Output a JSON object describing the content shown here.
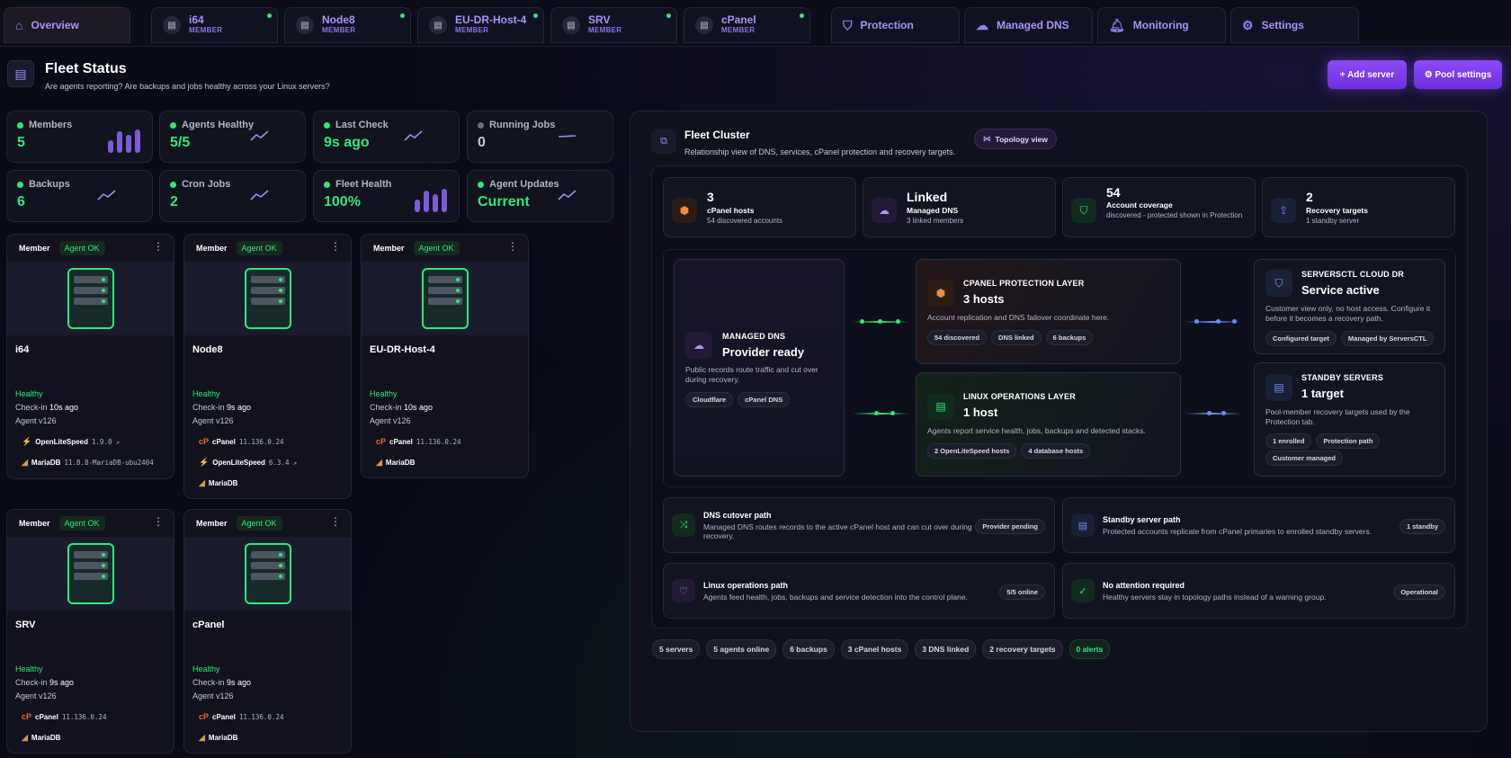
{
  "tabs": {
    "overview": {
      "label": "Overview"
    },
    "members": [
      {
        "name": "i64",
        "role": "MEMBER"
      },
      {
        "name": "Node8",
        "role": "MEMBER"
      },
      {
        "name": "EU-DR-Host-4",
        "role": "MEMBER"
      },
      {
        "name": "SRV",
        "role": "MEMBER"
      },
      {
        "name": "cPanel",
        "role": "MEMBER"
      }
    ],
    "sections": [
      {
        "label": "Protection",
        "icon": "shield-icon"
      },
      {
        "label": "Managed DNS",
        "icon": "cloud-icon"
      },
      {
        "label": "Monitoring",
        "icon": "bell-icon"
      },
      {
        "label": "Settings",
        "icon": "gear-icon"
      }
    ]
  },
  "header": {
    "title": "Fleet Status",
    "subtitle": "Are agents reporting? Are backups and jobs healthy across your Linux servers?",
    "add_server": "+ Add server",
    "pool_settings": "⚙ Pool settings"
  },
  "stats": [
    {
      "label": "Members",
      "value": "5",
      "status": "green"
    },
    {
      "label": "Agents Healthy",
      "value": "5/5",
      "status": "green"
    },
    {
      "label": "Last Check",
      "value": "9s ago",
      "status": "green"
    },
    {
      "label": "Running Jobs",
      "value": "0",
      "status": "gray"
    },
    {
      "label": "Backups",
      "value": "6",
      "status": "green"
    },
    {
      "label": "Cron Jobs",
      "value": "2",
      "status": "green"
    },
    {
      "label": "Fleet Health",
      "value": "100%",
      "status": "green"
    },
    {
      "label": "Agent Updates",
      "value": "Current",
      "status": "green"
    }
  ],
  "cards": [
    {
      "role": "Member",
      "badge": "Agent OK",
      "name": "i64",
      "health": "Healthy",
      "checkin_prefix": "Check-in ",
      "checkin": "10s ago",
      "agent": "Agent v126",
      "software": [
        {
          "name": "OpenLiteSpeed",
          "version": "1.9.0",
          "ext": "↗"
        },
        {
          "name": "MariaDB",
          "version": "11.8.8-MariaDB-ubu2404",
          "ext": ""
        }
      ]
    },
    {
      "role": "Member",
      "badge": "Agent OK",
      "name": "Node8",
      "health": "Healthy",
      "checkin_prefix": "Check-in ",
      "checkin": "9s ago",
      "agent": "Agent v126",
      "software": [
        {
          "name": "cPanel",
          "version": "11.136.0.24",
          "ext": ""
        },
        {
          "name": "OpenLiteSpeed",
          "version": "6.3.4",
          "ext": "↗"
        },
        {
          "name": "MariaDB",
          "version": "",
          "ext": ""
        }
      ]
    },
    {
      "role": "Member",
      "badge": "Agent OK",
      "name": "EU-DR-Host-4",
      "health": "Healthy",
      "checkin_prefix": "Check-in ",
      "checkin": "10s ago",
      "agent": "Agent v126",
      "software": [
        {
          "name": "cPanel",
          "version": "11.136.0.24",
          "ext": ""
        },
        {
          "name": "MariaDB",
          "version": "",
          "ext": ""
        }
      ]
    },
    {
      "role": "Member",
      "badge": "Agent OK",
      "name": "SRV",
      "health": "Healthy",
      "checkin_prefix": "Check-in ",
      "checkin": "9s ago",
      "agent": "Agent v126",
      "software": [
        {
          "name": "cPanel",
          "version": "11.136.0.24",
          "ext": ""
        },
        {
          "name": "MariaDB",
          "version": "",
          "ext": ""
        }
      ]
    },
    {
      "role": "Member",
      "badge": "Agent OK",
      "name": "cPanel",
      "health": "Healthy",
      "checkin_prefix": "Check-in ",
      "checkin": "9s ago",
      "agent": "Agent v126",
      "software": [
        {
          "name": "cPanel",
          "version": "11.136.0.24",
          "ext": ""
        },
        {
          "name": "MariaDB",
          "version": "",
          "ext": ""
        }
      ]
    }
  ],
  "cluster": {
    "title": "Fleet Cluster",
    "subtitle": "Relationship view of DNS, services, cPanel protection and recovery targets.",
    "topology_button": "Topology view",
    "kpis": [
      {
        "value": "3",
        "label": "cPanel hosts",
        "sub": "54 discovered accounts",
        "icon": "box-icon",
        "color": "#f08a3c"
      },
      {
        "value": "Linked",
        "label": "Managed DNS",
        "sub": "3 linked members",
        "icon": "cloud-icon",
        "color": "#a994f5"
      },
      {
        "value": "54",
        "label": "Account coverage",
        "sub": "discovered - protected shown in Protection",
        "icon": "shield-icon",
        "color": "#2ee87a"
      },
      {
        "value": "2",
        "label": "Recovery targets",
        "sub": "1 standby server",
        "icon": "cloud-upload-icon",
        "color": "#6c8cf5"
      }
    ],
    "dns": {
      "title": "MANAGED DNS",
      "value": "Provider ready",
      "desc": "Public records route traffic and cut over during recovery.",
      "pills": [
        "Cloudflare",
        "cPanel DNS"
      ]
    },
    "cpanel": {
      "title": "CPANEL PROTECTION LAYER",
      "value": "3 hosts",
      "desc": "Account replication and DNS failover coordinate here.",
      "pills": [
        "54 discovered",
        "DNS linked",
        "6 backups"
      ]
    },
    "linux": {
      "title": "LINUX OPERATIONS LAYER",
      "value": "1 host",
      "desc": "Agents report service health, jobs, backups and detected stacks.",
      "pills": [
        "2 OpenLiteSpeed hosts",
        "4 database hosts"
      ]
    },
    "clouddr": {
      "title": "SERVERSCTL CLOUD DR",
      "value": "Service active",
      "desc": "Customer view only, no host access. Configure it before it becomes a recovery path.",
      "pills": [
        "Configured target",
        "Managed by ServersCTL"
      ]
    },
    "standby": {
      "title": "STANDBY SERVERS",
      "value": "1 target",
      "desc": "Pool-member recovery targets used by the Protection tab.",
      "pills": [
        "1 enrolled",
        "Protection path",
        "Customer managed"
      ]
    },
    "paths": [
      {
        "title": "DNS cutover path",
        "desc": "Managed DNS routes records to the active cPanel host and can cut over during recovery.",
        "badge": "Provider pending",
        "icon": "shuffle-icon",
        "color": "#2ee87a"
      },
      {
        "title": "Standby server path",
        "desc": "Protected accounts replicate from cPanel primaries to enrolled standby servers.",
        "badge": "1 standby",
        "icon": "server-list-icon",
        "color": "#6c8cf5"
      },
      {
        "title": "Linux operations path",
        "desc": "Agents feed health, jobs, backups and service detection into the control plane.",
        "badge": "5/5 online",
        "icon": "heart-pulse-icon",
        "color": "#a994f5"
      },
      {
        "title": "No attention required",
        "desc": "Healthy servers stay in topology paths instead of a warning group.",
        "badge": "Operational",
        "icon": "check-circle-icon",
        "color": "#2ee87a"
      }
    ],
    "footer": [
      "5 servers",
      "5 agents online",
      "6 backups",
      "3 cPanel hosts",
      "3 DNS linked",
      "2 recovery targets",
      "0 alerts"
    ]
  }
}
